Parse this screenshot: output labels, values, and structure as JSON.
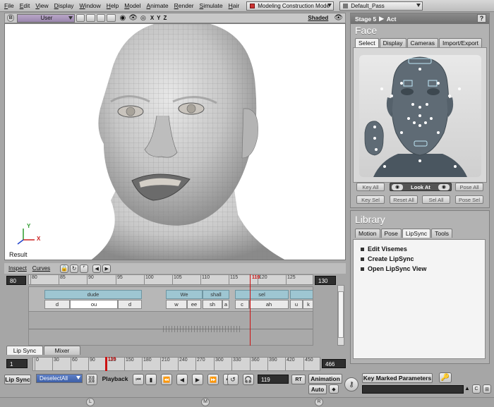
{
  "menubar": {
    "items": [
      "File",
      "Edit",
      "View",
      "Display",
      "Window",
      "Help",
      "Model",
      "Animate",
      "Render",
      "Simulate",
      "Hair"
    ],
    "mode_combo": "Modeling Construction Mode",
    "pass_combo": "Default_Pass"
  },
  "viewport": {
    "camera": "User",
    "shading": "Shaded",
    "result_label": "Result",
    "axis_x": "X",
    "axis_y": "Y",
    "axis_z": "Z"
  },
  "face_panel": {
    "breadcrumb_stage": "Stage 5",
    "breadcrumb_act": "Act",
    "help": "?",
    "title": "Face",
    "tabs": [
      "Select",
      "Display",
      "Cameras",
      "Import/Export"
    ],
    "active_tab": "Select",
    "buttons": {
      "key_all": "Key All",
      "look_at": "Look At",
      "pose_all": "Pose All",
      "key_sel": "Key Sel",
      "reset_all": "Reset All",
      "sel_all": "Sel All",
      "pose_sel": "Pose Sel"
    }
  },
  "library": {
    "title": "Library",
    "tabs": [
      "Motion",
      "Pose",
      "LipSync",
      "Tools"
    ],
    "active_tab": "LipSync",
    "items": [
      "Edit Visemes",
      "Create LipSync",
      "Open LipSync View"
    ]
  },
  "lipsync_editor": {
    "toolbar": {
      "inspect": "Inspect",
      "curves": "Curves"
    },
    "start": "80",
    "end": "130",
    "current_frame": "119",
    "ruler_ticks": [
      "80",
      "85",
      "90",
      "95",
      "100",
      "105",
      "110",
      "115",
      "120",
      "125"
    ],
    "words": [
      {
        "text": "dude"
      },
      {
        "text": "We"
      },
      {
        "text": "shall"
      },
      {
        "text": "sel"
      }
    ],
    "visemes": [
      "d",
      "ou",
      "d",
      "w",
      "ee",
      "sh",
      "a",
      "c",
      "ah",
      "u",
      "k"
    ],
    "tabs": [
      "Lip Sync",
      "Mixer"
    ]
  },
  "timeline": {
    "start": "1",
    "end": "466",
    "current_frame": "119",
    "ticks": [
      "0",
      "30",
      "60",
      "90",
      "120",
      "150",
      "180",
      "210",
      "240",
      "270",
      "300",
      "330",
      "360",
      "390",
      "420",
      "450"
    ]
  },
  "bottom_controls": {
    "lipsync_label": "Lip Sync",
    "deselect": "DeselectAll",
    "playback": "Playback",
    "frame_value": "119",
    "rt": "RT",
    "animation": "Animation",
    "auto": "Auto",
    "key_marked": "Key Marked Parameters"
  },
  "statusbar": {
    "l": "L",
    "m": "M",
    "r": "R"
  },
  "colors": {
    "playhead": "#cc1111",
    "word_block": "#9ec6d2",
    "viewport_bg": "#ffffff"
  }
}
